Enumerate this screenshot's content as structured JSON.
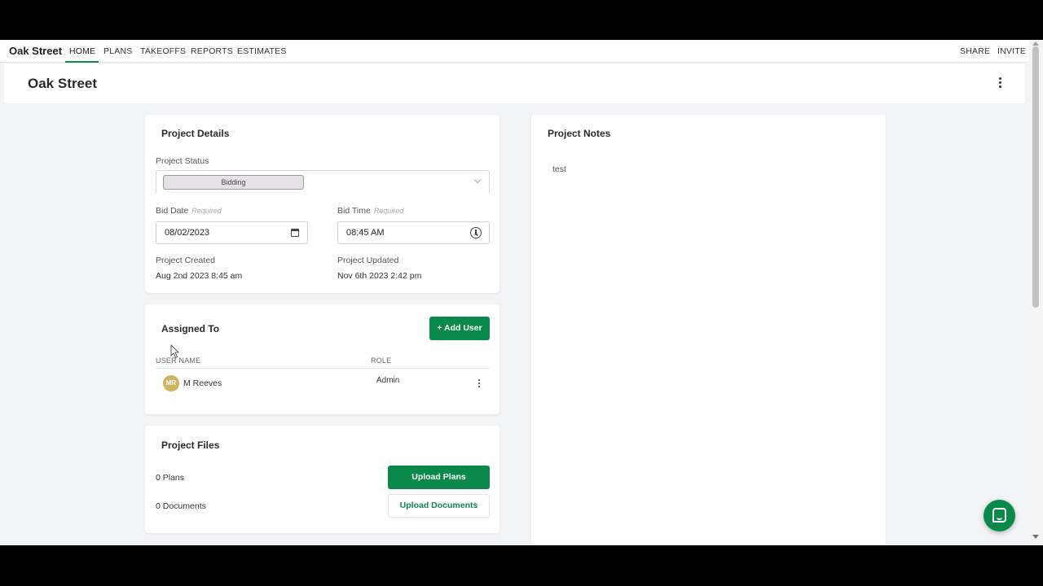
{
  "nav": {
    "brand": "Oak Street",
    "items": [
      "HOME",
      "PLANS",
      "TAKEOFFS",
      "REPORTS",
      "ESTIMATES"
    ],
    "active": "HOME",
    "share": "SHARE",
    "invite": "INVITE"
  },
  "header": {
    "title": "Oak Street"
  },
  "details": {
    "title": "Project Details",
    "status_label": "Project Status",
    "status_value": "Bidding",
    "bid_date_label": "Bid Date",
    "bid_date_req": "Required",
    "bid_date_value": "08/02/2023",
    "bid_time_label": "Bid Time",
    "bid_time_req": "Required",
    "bid_time_value": "08:45 AM",
    "created_label": "Project Created",
    "created_value": "Aug 2nd 2023 8:45 am",
    "updated_label": "Project Updated",
    "updated_value": "Nov 6th 2023 2:42 pm"
  },
  "assigned": {
    "title": "Assigned To",
    "add_user_label": "+ Add User",
    "col_username": "USER NAME",
    "col_role": "ROLE",
    "users": [
      {
        "initials": "MR",
        "name": "M Reeves",
        "role": "Admin"
      }
    ]
  },
  "files": {
    "title": "Project Files",
    "plans_count": "0 Plans",
    "documents_count": "0 Documents",
    "upload_plans_label": "Upload Plans",
    "upload_documents_label": "Upload Documents"
  },
  "notes": {
    "title": "Project Notes",
    "body": "test"
  },
  "colors": {
    "accent": "#0a8a4a",
    "avatar": "#d1b25f",
    "status_chip": "#e6e1e6"
  }
}
